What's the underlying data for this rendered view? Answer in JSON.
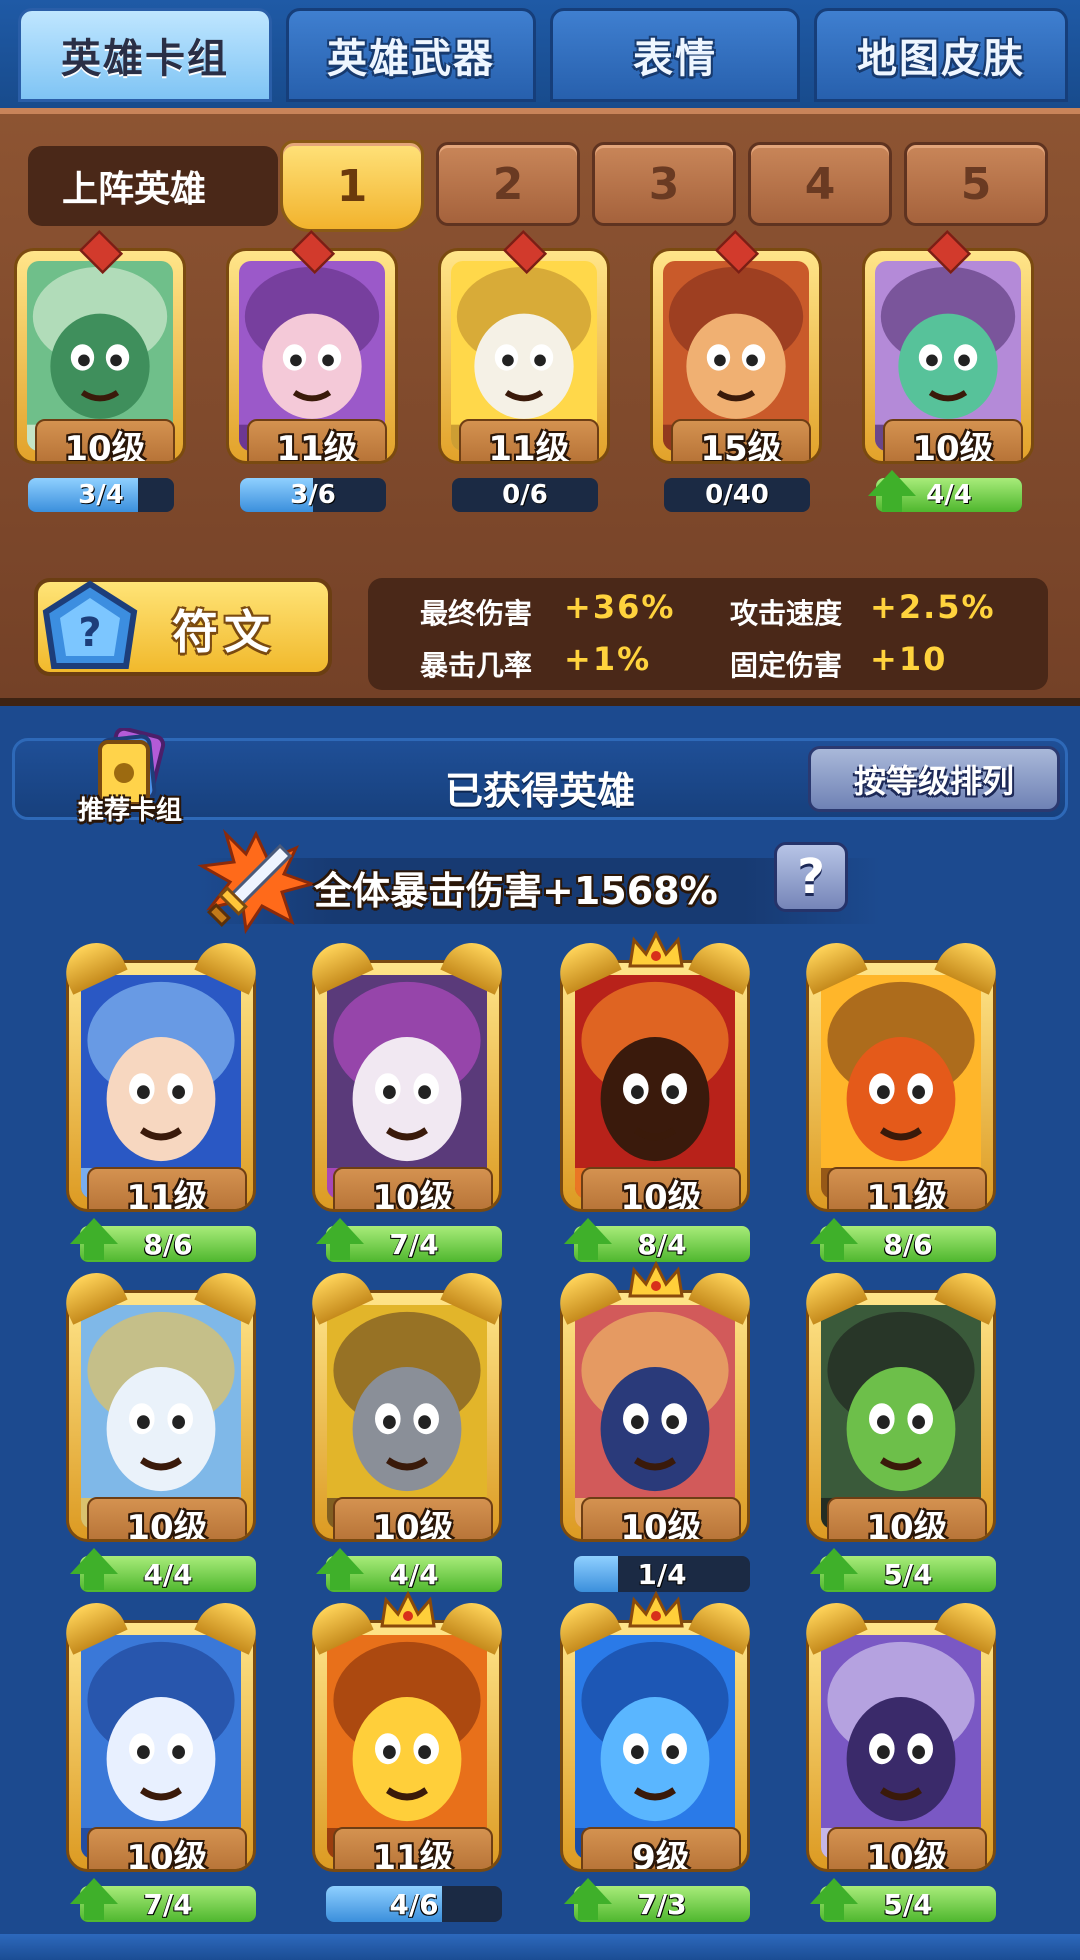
{
  "tabs": [
    {
      "label": "英雄卡组",
      "active": true
    },
    {
      "label": "英雄武器",
      "active": false
    },
    {
      "label": "表情",
      "active": false
    },
    {
      "label": "地图皮肤",
      "active": false
    }
  ],
  "lineup": {
    "label": "上阵英雄",
    "slots": [
      "1",
      "2",
      "3",
      "4",
      "5"
    ],
    "active_slot": 0
  },
  "lineup_heroes": [
    {
      "level": "10级",
      "progress": "3/4",
      "fill": 0.75,
      "upgradable": false,
      "art": "green-zombie"
    },
    {
      "level": "11级",
      "progress": "3/6",
      "fill": 0.5,
      "upgradable": false,
      "art": "purple-girl"
    },
    {
      "level": "11级",
      "progress": "0/6",
      "fill": 0.0,
      "upgradable": false,
      "art": "chef-blob"
    },
    {
      "level": "15级",
      "progress": "0/40",
      "fill": 0.0,
      "upgradable": false,
      "art": "monkey-king"
    },
    {
      "level": "10级",
      "progress": "4/4",
      "fill": 1.0,
      "upgradable": true,
      "art": "medusa"
    }
  ],
  "rune": {
    "label": "符文"
  },
  "stats": [
    {
      "name": "最终伤害",
      "value": "+36%"
    },
    {
      "name": "攻击速度",
      "value": "+2.5%"
    },
    {
      "name": "暴击几率",
      "value": "+1%"
    },
    {
      "name": "固定伤害",
      "value": "+10"
    }
  ],
  "owned": {
    "title": "已获得英雄",
    "sort_label": "按等级排列",
    "recommend_label": "推荐卡组",
    "crit_bonus": "全体暴击伤害+1568%",
    "help_label": "?"
  },
  "owned_heroes": [
    {
      "level": "11级",
      "progress": "8/6",
      "fill": 1.0,
      "upgradable": true,
      "crown": false,
      "art": "blue-hair-girl"
    },
    {
      "level": "10级",
      "progress": "7/4",
      "fill": 1.0,
      "upgradable": true,
      "crown": false,
      "art": "skull-knight"
    },
    {
      "level": "10级",
      "progress": "8/4",
      "fill": 1.0,
      "upgradable": true,
      "crown": true,
      "art": "hooded-mage"
    },
    {
      "level": "11级",
      "progress": "8/6",
      "fill": 1.0,
      "upgradable": true,
      "crown": false,
      "art": "yellow-hood"
    },
    {
      "level": "10级",
      "progress": "4/4",
      "fill": 1.0,
      "upgradable": true,
      "crown": false,
      "art": "zeus"
    },
    {
      "level": "10级",
      "progress": "4/4",
      "fill": 1.0,
      "upgradable": true,
      "crown": false,
      "art": "helmet-blob"
    },
    {
      "level": "10级",
      "progress": "1/4",
      "fill": 0.25,
      "upgradable": false,
      "crown": true,
      "art": "pirate-captain"
    },
    {
      "level": "10级",
      "progress": "5/4",
      "fill": 1.0,
      "upgradable": true,
      "crown": false,
      "art": "green-witch"
    },
    {
      "level": "10级",
      "progress": "7/4",
      "fill": 1.0,
      "upgradable": true,
      "crown": false,
      "art": "ice-knight"
    },
    {
      "level": "11级",
      "progress": "4/6",
      "fill": 0.66,
      "upgradable": false,
      "crown": true,
      "art": "tiger-warrior"
    },
    {
      "level": "9级",
      "progress": "7/3",
      "fill": 1.0,
      "upgradable": true,
      "crown": true,
      "art": "blue-golem"
    },
    {
      "level": "10级",
      "progress": "5/4",
      "fill": 1.0,
      "upgradable": true,
      "crown": false,
      "art": "octopus-pirate"
    }
  ]
}
